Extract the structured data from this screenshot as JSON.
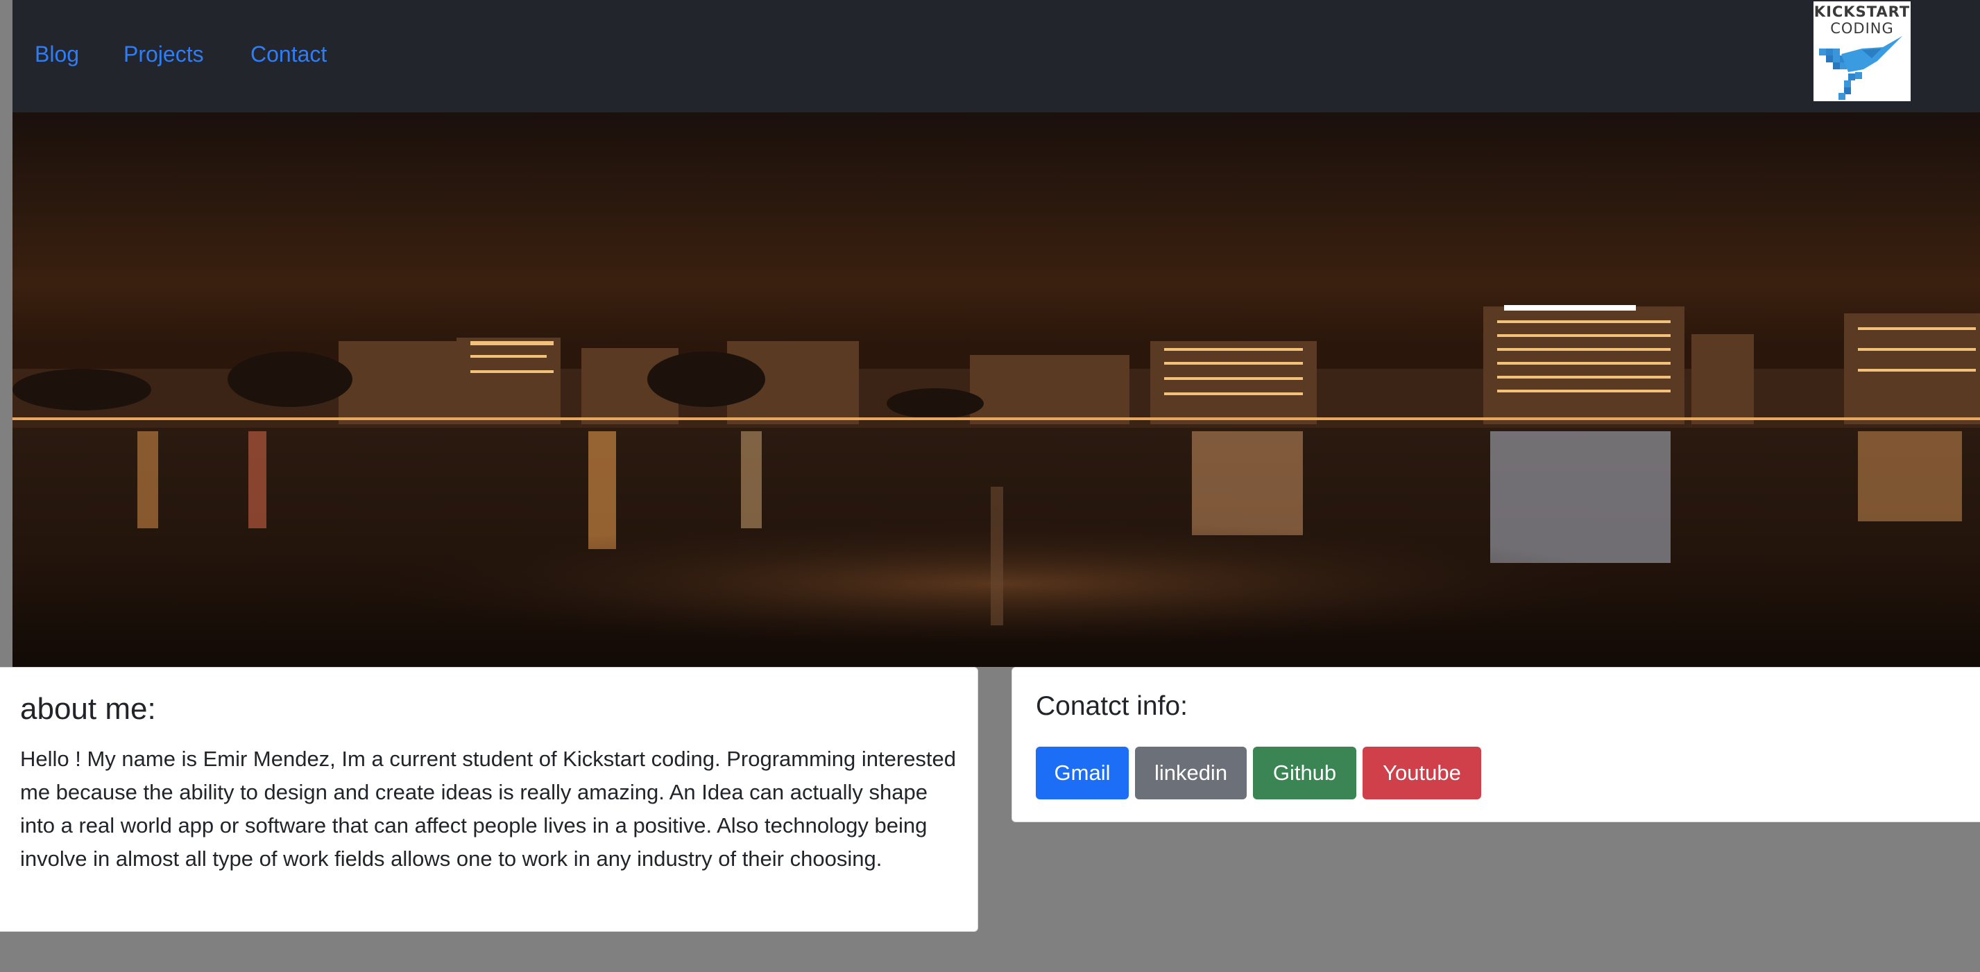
{
  "nav": {
    "links": [
      "Blog",
      "Projects",
      "Contact"
    ]
  },
  "logo": {
    "line1": "KICKSTART",
    "line2": "CODING"
  },
  "about": {
    "title": "about me:",
    "text": "Hello ! My name is Emir Mendez, Im a current student of Kickstart coding. Programming interested me because the ability to design and create ideas is really amazing. An Idea can actually shape into a real world app or software that can affect people lives in a positive. Also technology being involve in almost all type of work fields allows one to work in any industry of their choosing."
  },
  "contact": {
    "title": "Conatct info:",
    "buttons": [
      "Gmail",
      "linkedin",
      "Github",
      "Youtube"
    ]
  },
  "colors": {
    "navbar": "#22262c",
    "link": "#2f7df6",
    "page_background": "#808080",
    "gmail": "#1d6ef6",
    "linkedin": "#6b7079",
    "github": "#3b8453",
    "youtube": "#d0404a"
  }
}
